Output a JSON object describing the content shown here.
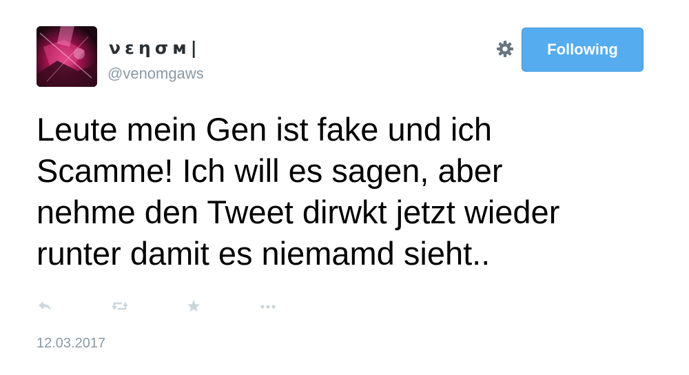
{
  "profile": {
    "display_name": "νεησм|",
    "username": "@venomgaws"
  },
  "header": {
    "follow_label": "Following",
    "settings_icon": "gear-icon",
    "follow_color": "#55acee"
  },
  "tweet": {
    "text": "Leute mein Gen ist fake und ich\nScamme! Ich will es sagen, aber\nnehme den Tweet dirwkt jetzt wieder\nrunter damit es niemamd sieht..",
    "timestamp": "12.03.2017"
  },
  "actions": [
    {
      "icon": "reply-icon"
    },
    {
      "icon": "retweet-icon"
    },
    {
      "icon": "favorite-star-icon"
    },
    {
      "icon": "more-icon"
    }
  ]
}
